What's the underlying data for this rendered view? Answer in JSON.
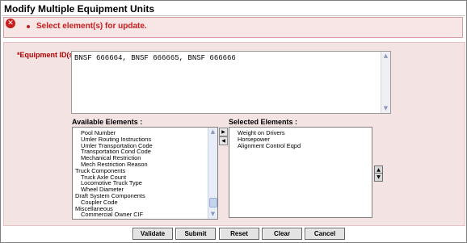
{
  "page": {
    "title": "Modify Multiple Equipment Units"
  },
  "error": {
    "message": "Select element(s) for update.",
    "icon": "error-x-icon"
  },
  "equipment": {
    "label": "*Equipment ID(s):",
    "value": "BNSF 666664, BNSF 666665, BNSF 666666"
  },
  "available": {
    "label": "Available Elements :",
    "items": [
      {
        "text": "Pool Number",
        "child": true
      },
      {
        "text": "Umler Routing Instructions",
        "child": true
      },
      {
        "text": "Umler Transportation Code",
        "child": true
      },
      {
        "text": "Transportation Cond Code",
        "child": true
      },
      {
        "text": "Mechanical Restriction",
        "child": true
      },
      {
        "text": "Mech Restriction Reason",
        "child": true
      },
      {
        "text": "Truck Components",
        "child": false
      },
      {
        "text": "Truck Axle Count",
        "child": true
      },
      {
        "text": "Locomotive Truck Type",
        "child": true
      },
      {
        "text": "Wheel Diameter",
        "child": true
      },
      {
        "text": "Draft System Components",
        "child": false
      },
      {
        "text": "Coupler Code",
        "child": true
      },
      {
        "text": "Miscellaneous",
        "child": false
      },
      {
        "text": "Commercial Owner CIF",
        "child": true
      }
    ]
  },
  "selected": {
    "label": "Selected Elements :",
    "items": [
      "Weight on Drivers",
      "Horsepower",
      "Alignment Control Eqpd"
    ]
  },
  "move": {
    "add_glyph": "▶",
    "remove_glyph": "◀"
  },
  "order": {
    "up_glyph": "▲",
    "down_glyph": "▼"
  },
  "buttons": {
    "validate": "Validate",
    "submit": "Submit",
    "reset": "Reset",
    "clear": "Clear",
    "cancel": "Cancel"
  }
}
